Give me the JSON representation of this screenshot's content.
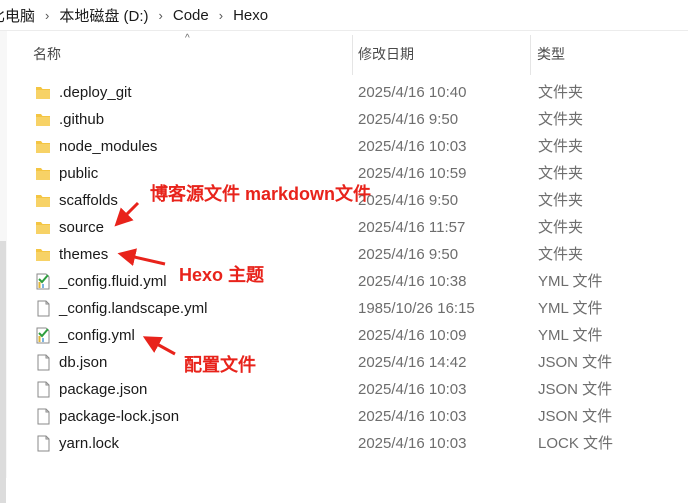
{
  "breadcrumb": {
    "items": [
      "比电脑",
      "本地磁盘 (D:)",
      "Code",
      "Hexo"
    ],
    "separator": "›"
  },
  "columns": {
    "name": "名称",
    "date": "修改日期",
    "type": "类型",
    "sort_indicator": "^"
  },
  "files": [
    {
      "name": ".deploy_git",
      "date": "2025/4/16 10:40",
      "type": "文件夹",
      "icon": "folder-icon"
    },
    {
      "name": ".github",
      "date": "2025/4/16 9:50",
      "type": "文件夹",
      "icon": "folder-icon"
    },
    {
      "name": "node_modules",
      "date": "2025/4/16 10:03",
      "type": "文件夹",
      "icon": "folder-icon"
    },
    {
      "name": "public",
      "date": "2025/4/16 10:59",
      "type": "文件夹",
      "icon": "folder-icon"
    },
    {
      "name": "scaffolds",
      "date": "2025/4/16 9:50",
      "type": "文件夹",
      "icon": "folder-icon"
    },
    {
      "name": "source",
      "date": "2025/4/16 11:57",
      "type": "文件夹",
      "icon": "folder-icon"
    },
    {
      "name": "themes",
      "date": "2025/4/16 9:50",
      "type": "文件夹",
      "icon": "folder-icon"
    },
    {
      "name": "_config.fluid.yml",
      "date": "2025/4/16 10:38",
      "type": "YML 文件",
      "icon": "yml-file-icon"
    },
    {
      "name": "_config.landscape.yml",
      "date": "1985/10/26 16:15",
      "type": "YML 文件",
      "icon": "blank-file-icon"
    },
    {
      "name": "_config.yml",
      "date": "2025/4/16 10:09",
      "type": "YML 文件",
      "icon": "yml-file-icon"
    },
    {
      "name": "db.json",
      "date": "2025/4/16 14:42",
      "type": "JSON 文件",
      "icon": "blank-file-icon"
    },
    {
      "name": "package.json",
      "date": "2025/4/16 10:03",
      "type": "JSON 文件",
      "icon": "blank-file-icon"
    },
    {
      "name": "package-lock.json",
      "date": "2025/4/16 10:03",
      "type": "JSON 文件",
      "icon": "blank-file-icon"
    },
    {
      "name": "yarn.lock",
      "date": "2025/4/16 10:03",
      "type": "LOCK 文件",
      "icon": "blank-file-icon"
    }
  ],
  "annotations": {
    "source": "博客源文件 markdown文件",
    "themes": "Hexo 主题",
    "config": "配置文件",
    "color": "#e8231b"
  },
  "colors": {
    "folder": "#f4c542",
    "yml_check": "#2e9e3e",
    "yml_bar": "#e2b533"
  }
}
